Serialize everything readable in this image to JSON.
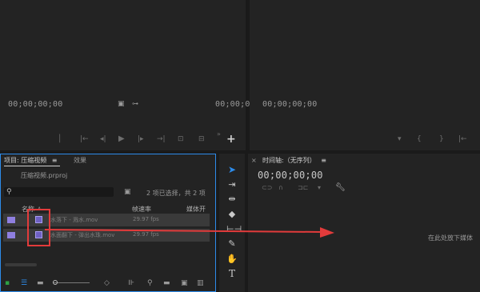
{
  "source_monitor": {
    "timecode_left": "00;00;00;00",
    "timecode_right": "00;00;0"
  },
  "program_monitor": {
    "timecode_left": "00;00;00;00"
  },
  "project_panel": {
    "tab_label": "项目: 压缩视频",
    "effects_tab": "效果",
    "project_file": "压缩视频.prproj",
    "selection_status": "2 项已选择，共 2 项",
    "columns": {
      "name": "名称",
      "framerate": "帧速率",
      "media_start": "媒体开"
    },
    "rows": [
      {
        "name": "水落下 - 溅水.mov",
        "fps": "29.97 fps"
      },
      {
        "name": "水面翻下 - 弹出水珠.mov",
        "fps": "29.97 fps"
      }
    ]
  },
  "timeline": {
    "title": "时间轴:（无序列）",
    "timecode": "00;00;00;00",
    "drop_hint": "在此处放下媒体"
  },
  "colors": {
    "accent_blue": "#2d8ceb",
    "annotation_red": "#e23b3b",
    "clip_violet": "#8f7fe0"
  }
}
